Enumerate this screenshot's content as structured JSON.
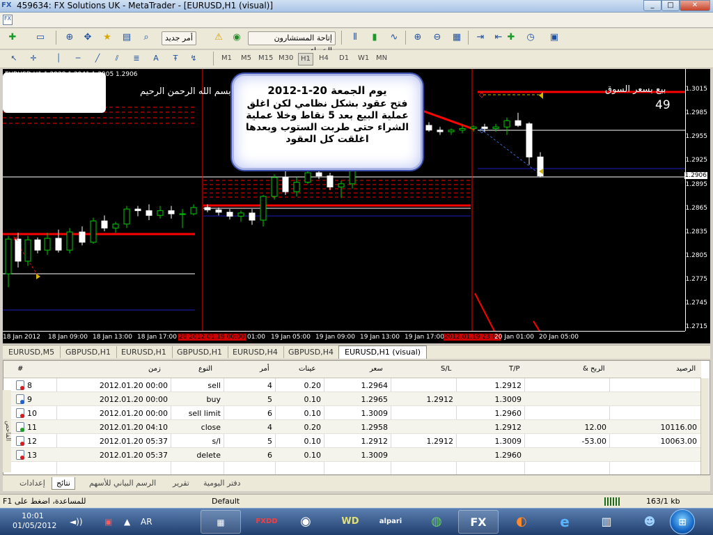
{
  "window": {
    "title": "459634: FX Solutions UK - MetaTrader - [EURUSD,H1 (visual)]",
    "logo": "FX",
    "min": "_",
    "max": "□",
    "close": "✕"
  },
  "menubar": {
    "file_icon": "FX"
  },
  "toolbar1": {
    "new_order_label": "أمر جديد",
    "experts_label": "إتاحة المستشارون الخبراء"
  },
  "toolbar2": {
    "timeframes": [
      "M1",
      "M5",
      "M15",
      "M30",
      "H1",
      "H4",
      "D1",
      "W1",
      "MN"
    ],
    "active_timeframe": "H1",
    "text_tool": "A"
  },
  "chart": {
    "symbol_info": "EURUSD,H1  1.2928 1.2941 1.2905 1.2906",
    "bismillah": "بسم الله الرحمن الرحيم",
    "sell_market": "بيع بسعر السوق",
    "points": "49",
    "price_labels": [
      "1.3015",
      "1.2985",
      "1.2955",
      "1.2925",
      "1.2906",
      "1.2895",
      "1.2865",
      "1.2835",
      "1.2805",
      "1.2775",
      "1.2745",
      "1.2715"
    ],
    "time_labels": [
      "18 Jan 2012",
      "18 Jan 09:00",
      "18 Jan 13:00",
      "18 Jan 17:00",
      "20 2012.01.19 00:00",
      "01:00",
      "19 Jan 05:00",
      "19 Jan 09:00",
      "19 Jan 13:00",
      "19 Jan 17:00",
      "2012.01.19 23:00",
      "20 Jan 01:00",
      "20 Jan 05:00"
    ],
    "colors": {
      "background": "#000000",
      "support_red": "#ff0000",
      "bull": "#00cc00",
      "bear": "#ffffff"
    }
  },
  "callout": {
    "line1": "يوم الجمعة 20-1-2012",
    "line2": "فتح عقود بشكل نظامي لكن اغلق عملية البيع بعد 5 نقاط وخلا عملية الشراء حتى طربت الستوب وبعدها اغلقت كل العقود"
  },
  "chart_tabs": [
    "EURUSD,M5",
    "GBPUSD,H1",
    "EURUSD,H1",
    "GBPUSD,H1",
    "EURUSD,H4",
    "GBPUSD,H4",
    "EURUSD,H1 (visual)"
  ],
  "terminal": {
    "headers": {
      "num": "#",
      "time": "زمن",
      "type": "النوع",
      "order": "أمر",
      "lots": "عينات",
      "price": "سعر",
      "sl": "S/L",
      "tp": "T/P",
      "profit": "الربح &",
      "balance": "الرصيد"
    },
    "rows": [
      {
        "num": "8",
        "time": "2012.01.20 00:00",
        "type": "sell",
        "order": "4",
        "lots": "0.20",
        "price": "1.2964",
        "sl": "",
        "tp": "1.2912",
        "profit": "",
        "balance": "",
        "icon": "sell"
      },
      {
        "num": "9",
        "time": "2012.01.20 00:00",
        "type": "buy",
        "order": "5",
        "lots": "0.10",
        "price": "1.2965",
        "sl": "1.2912",
        "tp": "1.3009",
        "profit": "",
        "balance": "",
        "icon": "buy"
      },
      {
        "num": "10",
        "time": "2012.01.20 00:00",
        "type": "sell limit",
        "order": "6",
        "lots": "0.10",
        "price": "1.3009",
        "sl": "",
        "tp": "1.2960",
        "profit": "",
        "balance": "",
        "icon": "pending"
      },
      {
        "num": "11",
        "time": "2012.01.20 04:10",
        "type": "close",
        "order": "4",
        "lots": "0.20",
        "price": "1.2958",
        "sl": "",
        "tp": "1.2912",
        "profit": "12.00",
        "balance": "10116.00",
        "icon": "close"
      },
      {
        "num": "12",
        "time": "2012.01.20 05:37",
        "type": "s/l",
        "order": "5",
        "lots": "0.10",
        "price": "1.2912",
        "sl": "1.2912",
        "tp": "1.3009",
        "profit": "-53.00",
        "balance": "10063.00",
        "icon": "sl"
      },
      {
        "num": "13",
        "time": "2012.01.20 05:37",
        "type": "delete",
        "order": "6",
        "lots": "0.10",
        "price": "1.3009",
        "sl": "",
        "tp": "1.2960",
        "profit": "",
        "balance": "",
        "icon": "delete"
      }
    ]
  },
  "side_label": "الفاحص",
  "terminal_tabs": [
    "إعدادات",
    "نتائج",
    "الرسم البياني للأسهم",
    "تقرير",
    "دفتر اليومية"
  ],
  "active_terminal_tab": "نتائج",
  "status": {
    "help": "للمساعدة، اضغط على F1",
    "profile": "Default",
    "traffic": "163/1 kb"
  },
  "taskbar": {
    "time": "10:01",
    "date": "01/05/2012",
    "lang": "AR",
    "apps": [
      "FXDD",
      "alpari",
      "FX"
    ]
  }
}
